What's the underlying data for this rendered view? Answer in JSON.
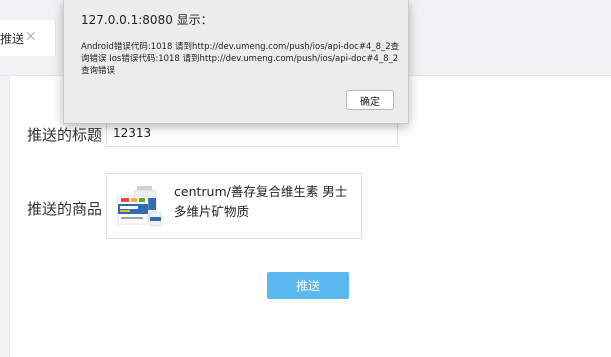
{
  "tab": {
    "label": "推送",
    "close_glyph": "✕"
  },
  "form": {
    "title_label": "推送的标题",
    "title_value": "12313",
    "goods_label": "推送的商品",
    "product_name": "centrum/善存复合维生素 男士多维片矿物质",
    "push_button_label": "推送"
  },
  "alert": {
    "title": "127.0.0.1:8080 显示：",
    "message": "Android错误代码:1018  请到http://dev.umeng.com/push/ios/api-doc#4_8_2查询错误      Ios错误代码:1018  请到http://dev.umeng.com/push/ios/api-doc#4_8_2查询错误",
    "ok_label": "确定"
  },
  "icons": {
    "tab_close": "close-icon",
    "product_image": "vitamin-bottle-image"
  },
  "colors": {
    "primary_button": "#5cb8f0",
    "dialog_background": "#ececec",
    "input_border": "#dcdfe3"
  }
}
